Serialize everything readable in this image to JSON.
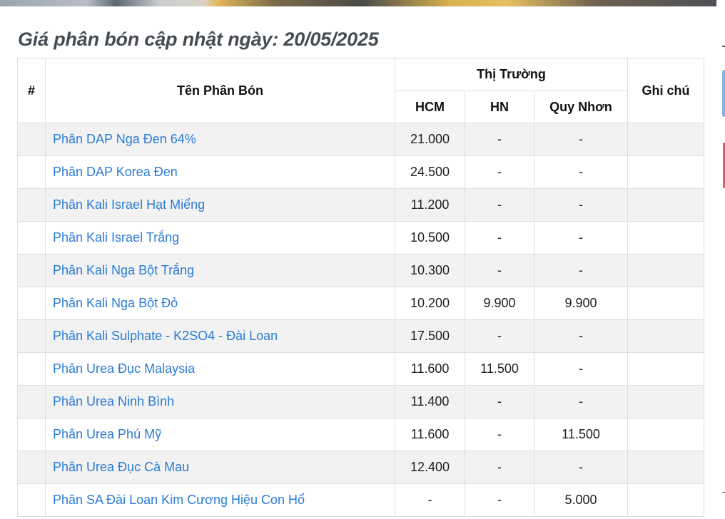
{
  "page": {
    "title": "Giá phân bón cập nhật ngày: 20/05/2025"
  },
  "table": {
    "headers": {
      "index": "#",
      "name": "Tên Phân Bón",
      "market": "Thị Trường",
      "hcm": "HCM",
      "hn": "HN",
      "quy_nhon": "Quy Nhơn",
      "note": "Ghi chú"
    },
    "rows": [
      {
        "index": "",
        "name": "Phân DAP Nga Đen 64%",
        "hcm": "21.000",
        "hn": "-",
        "quy_nhon": "-",
        "note": ""
      },
      {
        "index": "",
        "name": "Phân DAP Korea Đen",
        "hcm": "24.500",
        "hn": "-",
        "quy_nhon": "-",
        "note": ""
      },
      {
        "index": "",
        "name": "Phân Kali Israel Hạt Miểng",
        "hcm": "11.200",
        "hn": "-",
        "quy_nhon": "-",
        "note": ""
      },
      {
        "index": "",
        "name": "Phân Kali Israel Trắng",
        "hcm": "10.500",
        "hn": "-",
        "quy_nhon": "-",
        "note": ""
      },
      {
        "index": "",
        "name": "Phân Kali Nga Bột Trắng",
        "hcm": "10.300",
        "hn": "-",
        "quy_nhon": "-",
        "note": ""
      },
      {
        "index": "",
        "name": "Phân Kali Nga Bột Đỏ",
        "hcm": "10.200",
        "hn": "9.900",
        "quy_nhon": "9.900",
        "note": ""
      },
      {
        "index": "",
        "name": "Phân Kali Sulphate - K2SO4 - Đài Loan",
        "hcm": "17.500",
        "hn": "-",
        "quy_nhon": "-",
        "note": ""
      },
      {
        "index": "",
        "name": "Phân Urea Đục Malaysia",
        "hcm": "11.600",
        "hn": "11.500",
        "quy_nhon": "-",
        "note": ""
      },
      {
        "index": "",
        "name": "Phân Urea Ninh Bình",
        "hcm": "11.400",
        "hn": "-",
        "quy_nhon": "-",
        "note": ""
      },
      {
        "index": "",
        "name": "Phân Urea Phú Mỹ",
        "hcm": "11.600",
        "hn": "-",
        "quy_nhon": "11.500",
        "note": ""
      },
      {
        "index": "",
        "name": "Phân Urea Đục Cà Mau",
        "hcm": "12.400",
        "hn": "-",
        "quy_nhon": "-",
        "note": ""
      },
      {
        "index": "",
        "name": "Phân SA Đài Loan Kim Cương Hiệu Con Hổ",
        "hcm": "-",
        "hn": "-",
        "quy_nhon": "5.000",
        "note": ""
      }
    ]
  },
  "colors": {
    "link": "#2b7bd6",
    "title": "#444b52",
    "row_stripe": "#f2f2f2",
    "border": "#dedede"
  }
}
